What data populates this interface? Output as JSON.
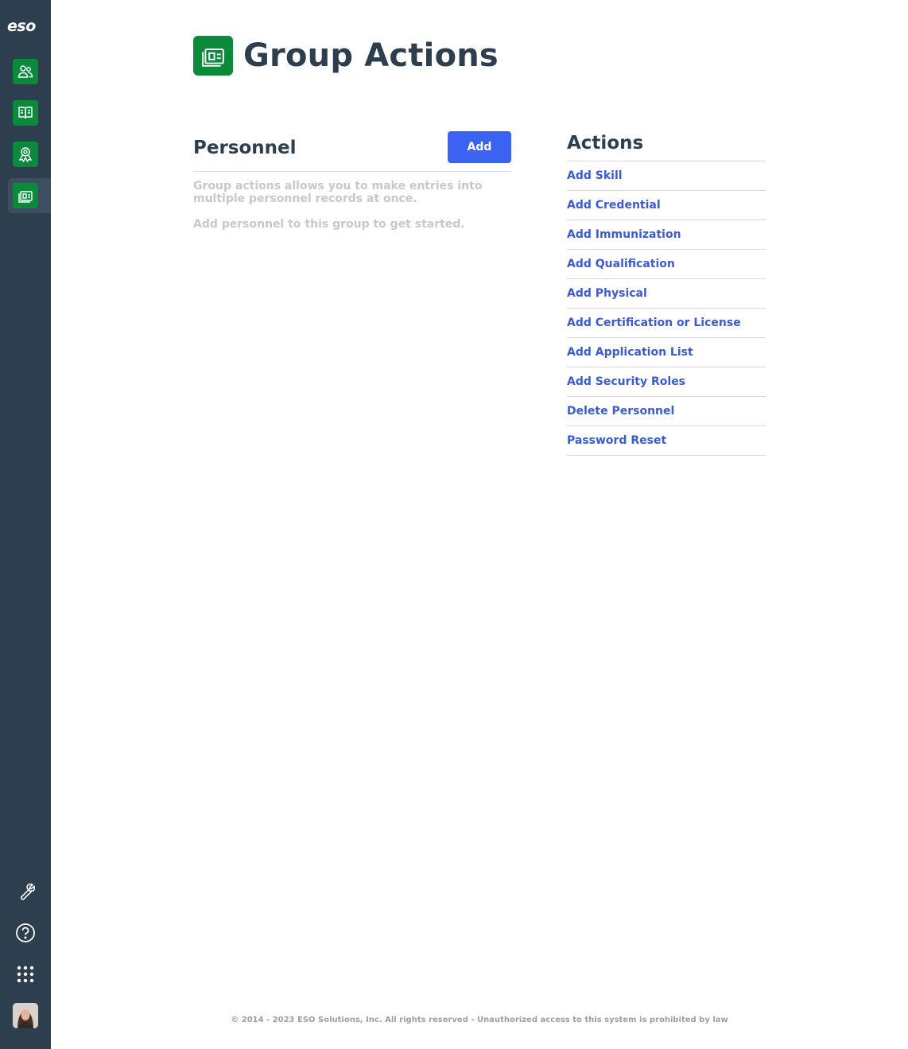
{
  "sidebar": {
    "logo": "eso",
    "nav": [
      {
        "name": "personnel",
        "icon": "people-icon"
      },
      {
        "name": "training",
        "icon": "book-icon"
      },
      {
        "name": "credentials",
        "icon": "award-icon"
      },
      {
        "name": "group-actions",
        "icon": "group-actions-icon",
        "active": true
      }
    ],
    "tools": [
      {
        "name": "settings",
        "icon": "wrench-icon"
      },
      {
        "name": "help",
        "icon": "help-icon"
      },
      {
        "name": "apps",
        "icon": "apps-grid-icon"
      }
    ]
  },
  "header": {
    "title": "Group Actions",
    "icon": "group-actions-icon"
  },
  "personnel": {
    "title": "Personnel",
    "add_label": "Add",
    "help_text": "Group actions allows you to make entries into multiple personnel records at once.",
    "help_text2": "Add personnel to this group to get started."
  },
  "actions": {
    "title": "Actions",
    "items": [
      {
        "label": "Add Skill"
      },
      {
        "label": "Add Credential"
      },
      {
        "label": "Add Immunization"
      },
      {
        "label": "Add Qualification"
      },
      {
        "label": "Add Physical"
      },
      {
        "label": "Add Certification or License"
      },
      {
        "label": "Add Application List"
      },
      {
        "label": "Add Security Roles"
      },
      {
        "label": "Delete Personnel"
      },
      {
        "label": "Password Reset"
      }
    ]
  },
  "footer": {
    "text": "© 2014 - 2023 ESO Solutions, Inc. All rights reserved - Unauthorized access to this system is prohibited by law"
  },
  "colors": {
    "sidebar_bg": "#2d3e4e",
    "accent_green": "#0b8a3c",
    "button_blue": "#3a63f4",
    "link_blue": "#3a5bd2"
  }
}
